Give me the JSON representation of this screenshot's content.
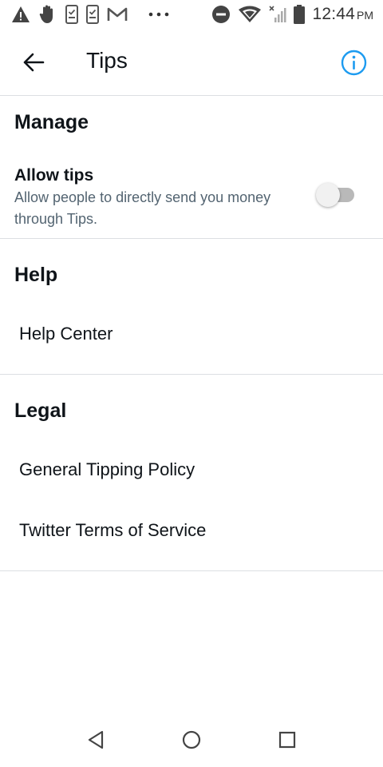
{
  "status_bar": {
    "time": "12:44",
    "ampm": "PM",
    "icons": [
      "warning-icon",
      "hand-icon",
      "phone-check-icon",
      "phone-check-icon",
      "gmail-icon",
      "more-dots-icon",
      "do-not-disturb-icon",
      "wifi-icon",
      "signal-icon",
      "battery-icon"
    ]
  },
  "header": {
    "title": "Tips",
    "back_icon": "arrow-left-icon",
    "info_icon": "info-icon",
    "accent_color": "#1d9bf0"
  },
  "sections": {
    "manage": {
      "title": "Manage",
      "allow_tips": {
        "title": "Allow tips",
        "description": "Allow people to directly send you money through Tips.",
        "enabled": false
      }
    },
    "help": {
      "title": "Help",
      "items": [
        "Help Center"
      ]
    },
    "legal": {
      "title": "Legal",
      "items": [
        "General Tipping Policy",
        "Twitter Terms of Service"
      ]
    }
  },
  "nav_bar": {
    "icons": [
      "back-triangle-icon",
      "home-circle-icon",
      "recents-square-icon"
    ]
  }
}
